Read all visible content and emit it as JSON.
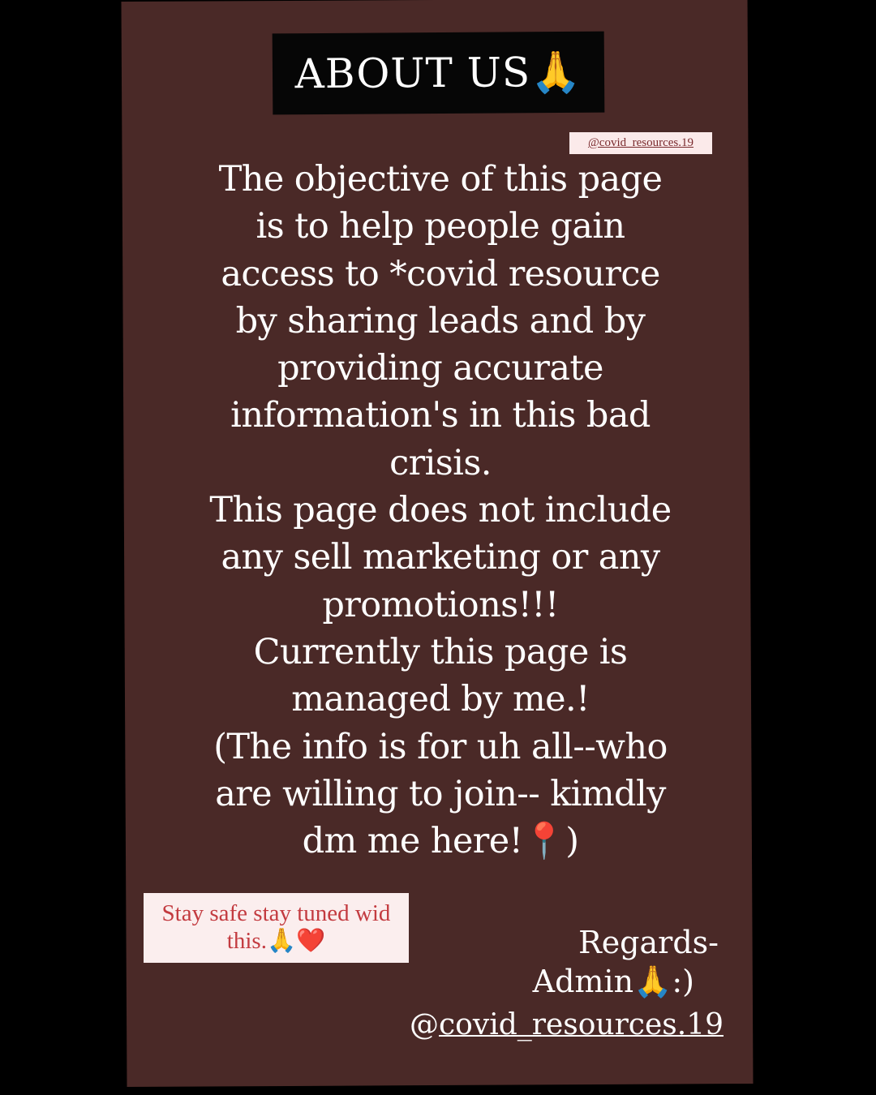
{
  "title": "ABOUT US🙏",
  "top_handle": "@covid_resources.19",
  "body_lines": [
    "The objective of this page",
    "is to help people gain",
    "access to *covid resource",
    "by sharing leads and by",
    "providing accurate",
    "information's in this bad",
    "crisis.",
    "This page does not include",
    "any sell marketing or any",
    "promotions!!!",
    "Currently this page is",
    "managed by me.!",
    "(The info is for uh all--who",
    "are willing to join-- kimdly",
    "dm me here!📍)"
  ],
  "stay_safe": {
    "line1": "Stay safe stay tuned wid",
    "line2": "this.🙏❤️"
  },
  "signature": {
    "regards": "Regards-",
    "admin": "Admin🙏:)",
    "at": "@",
    "handle": "covid_resources.19"
  },
  "colors": {
    "background": "#000000",
    "card": "#4a2927",
    "title_box": "#060606",
    "sticker": "#fbeeee",
    "sticker_text": "#c33b40"
  }
}
